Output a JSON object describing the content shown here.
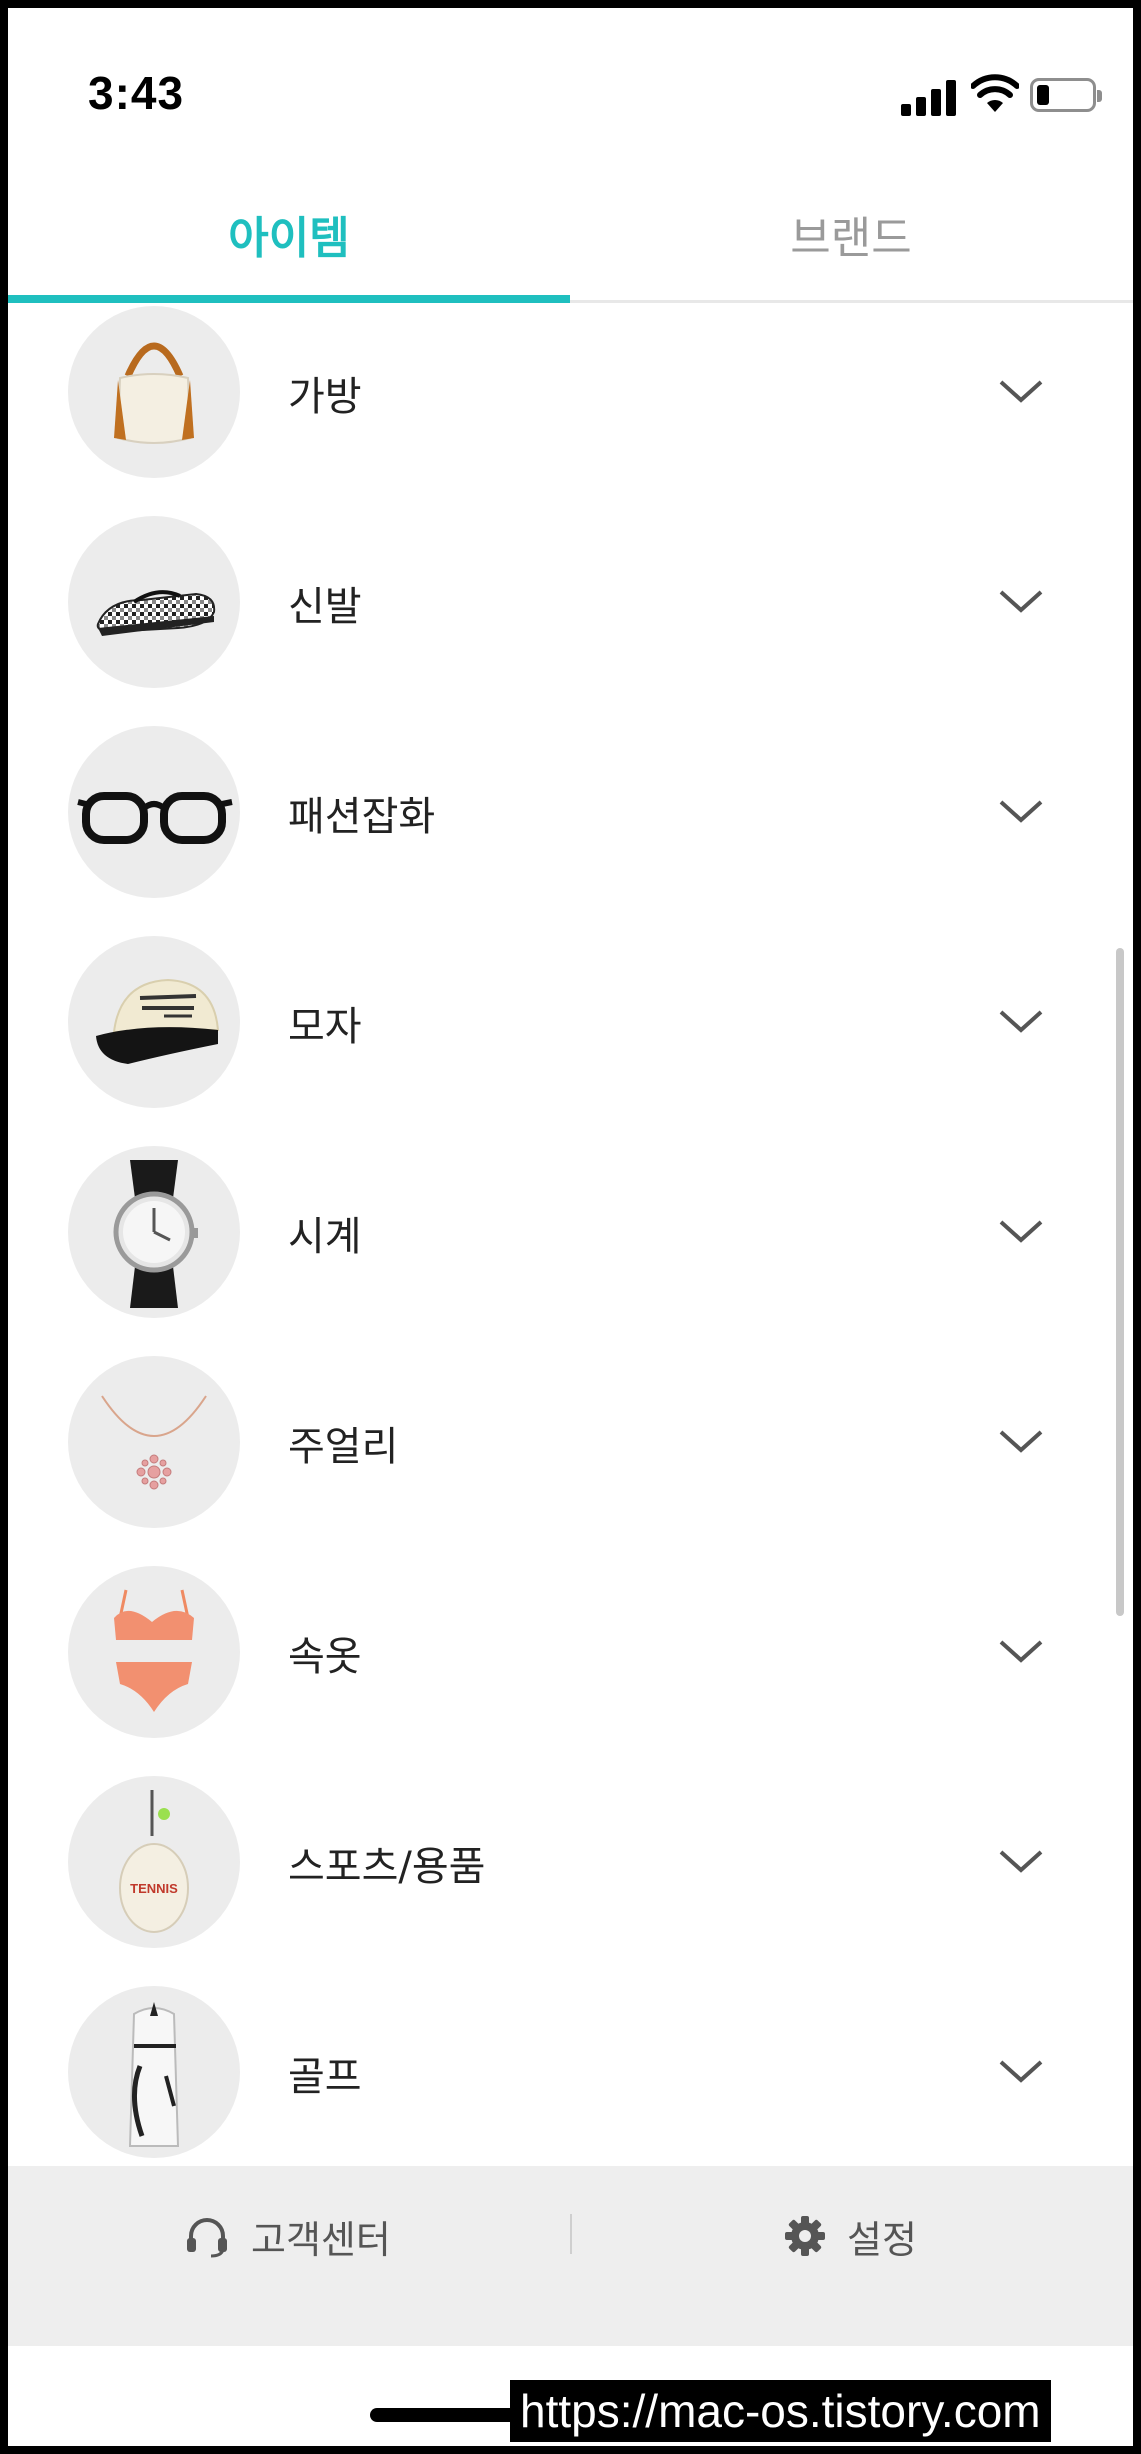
{
  "status_bar": {
    "time": "3:43"
  },
  "tabs": [
    {
      "label": "아이템",
      "active": true
    },
    {
      "label": "브랜드",
      "active": false
    }
  ],
  "categories": [
    {
      "label": "가방",
      "icon": "handbag-icon"
    },
    {
      "label": "신발",
      "icon": "shoe-icon"
    },
    {
      "label": "패션잡화",
      "icon": "glasses-icon"
    },
    {
      "label": "모자",
      "icon": "cap-icon"
    },
    {
      "label": "시계",
      "icon": "watch-icon"
    },
    {
      "label": "주얼리",
      "icon": "necklace-icon"
    },
    {
      "label": "속옷",
      "icon": "lingerie-icon"
    },
    {
      "label": "스포츠/용품",
      "icon": "tennis-racket-icon"
    },
    {
      "label": "골프",
      "icon": "golf-bag-icon"
    }
  ],
  "product_text": {
    "tennis": "TENNIS"
  },
  "footer": {
    "customer_center": "고객센터",
    "settings": "설정"
  },
  "watermark": "https://mac-os.tistory.com",
  "colors": {
    "accent": "#1fbfbf",
    "inactive_tab": "#9a9a9a",
    "thumb_bg": "#ececec",
    "footer_bg": "#eeeeee"
  }
}
